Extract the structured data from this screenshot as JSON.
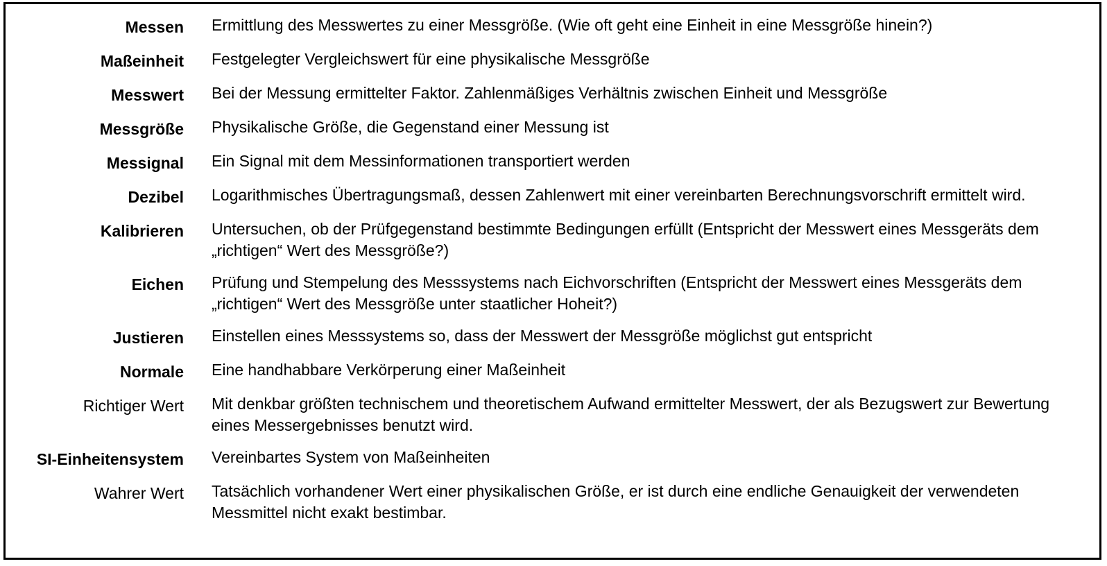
{
  "glossary": {
    "rows": [
      {
        "term": "Messen",
        "definition": "Ermittlung des Messwertes zu einer Messgröße. (Wie oft geht eine Einheit in eine Messgröße hinein?)"
      },
      {
        "term": "Maßeinheit",
        "definition": "Festgelegter Vergleichswert für eine physikalische Messgröße"
      },
      {
        "term": "Messwert",
        "definition": "Bei der Messung ermittelter Faktor. Zahlenmäßiges Verhältnis zwischen Einheit und Messgröße"
      },
      {
        "term": "Messgröße",
        "definition": "Physikalische Größe, die Gegenstand einer Messung ist"
      },
      {
        "term": "Messignal",
        "definition": "Ein Signal mit dem Messinformationen transportiert werden"
      },
      {
        "term": "Dezibel",
        "definition": "Logarithmisches Übertragungsmaß, dessen Zahlenwert mit einer vereinbarten Berechnungsvorschrift ermittelt wird."
      },
      {
        "term": "Kalibrieren",
        "definition": "Untersuchen, ob der Prüfgegenstand bestimmte Bedingungen erfüllt (Entspricht der Messwert eines Messgeräts dem „richtigen“ Wert des Messgröße?)"
      },
      {
        "term": "Eichen",
        "definition": "Prüfung und Stempelung des Messsystems nach Eichvorschriften (Entspricht der Messwert eines Messgeräts dem „richtigen“ Wert des Messgröße unter staatlicher Hoheit?)"
      },
      {
        "term": "Justieren",
        "definition": "Einstellen eines Messsystems so, dass der Messwert der Messgröße möglichst gut entspricht"
      },
      {
        "term": "Normale",
        "definition": "Eine handhabbare Verkörperung einer Maßeinheit"
      },
      {
        "term": "Richtiger Wert",
        "definition": "Mit denkbar größten technischem und theoretischem Aufwand ermittelter Messwert, der als Bezugswert zur Bewertung eines Messergebnisses benutzt wird."
      },
      {
        "term": "SI-Einheitensystem",
        "definition": "Vereinbartes System von Maßeinheiten"
      },
      {
        "term": "Wahrer Wert",
        "definition": "Tatsächlich vorhandener Wert einer physikalischen Größe, er ist durch eine endliche Genauigkeit der verwendeten Messmittel nicht exakt bestimbar."
      }
    ]
  }
}
